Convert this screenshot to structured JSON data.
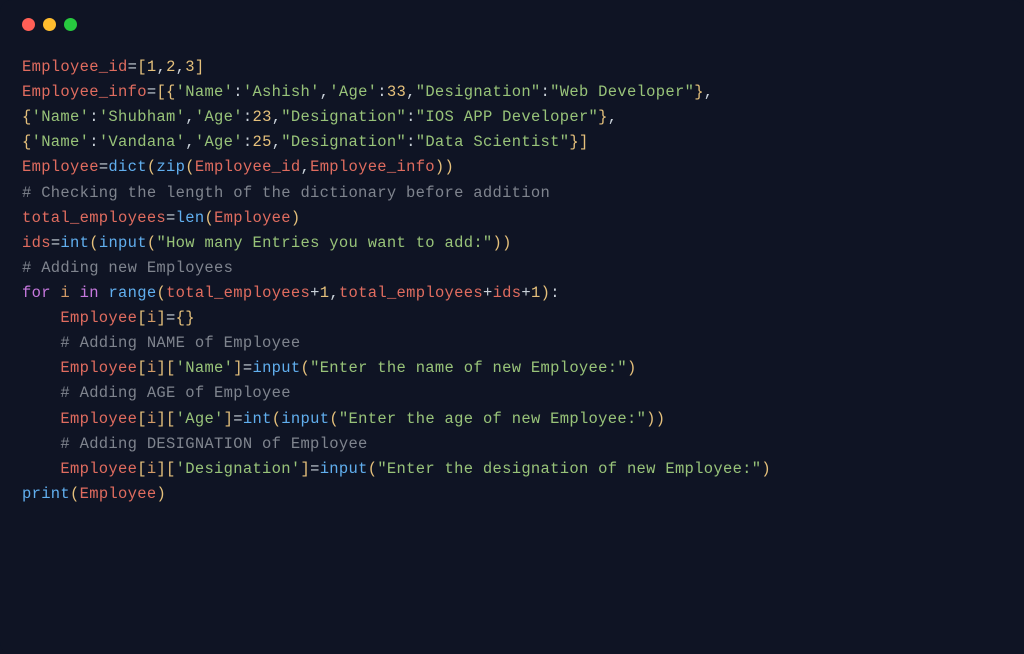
{
  "window": {
    "controls": [
      "close",
      "minimize",
      "maximize"
    ]
  },
  "code": {
    "lines": [
      [
        {
          "t": "Employee_id",
          "c": "var"
        },
        {
          "t": "=",
          "c": "op"
        },
        {
          "t": "[",
          "c": "br"
        },
        {
          "t": "1",
          "c": "num"
        },
        {
          "t": ",",
          "c": "pun"
        },
        {
          "t": "2",
          "c": "num"
        },
        {
          "t": ",",
          "c": "pun"
        },
        {
          "t": "3",
          "c": "num"
        },
        {
          "t": "]",
          "c": "br"
        }
      ],
      [
        {
          "t": "Employee_info",
          "c": "var"
        },
        {
          "t": "=",
          "c": "op"
        },
        {
          "t": "[{",
          "c": "br"
        },
        {
          "t": "'Name'",
          "c": "str"
        },
        {
          "t": ":",
          "c": "pun"
        },
        {
          "t": "'Ashish'",
          "c": "str"
        },
        {
          "t": ",",
          "c": "pun"
        },
        {
          "t": "'Age'",
          "c": "str"
        },
        {
          "t": ":",
          "c": "pun"
        },
        {
          "t": "33",
          "c": "num"
        },
        {
          "t": ",",
          "c": "pun"
        },
        {
          "t": "\"Designation\"",
          "c": "str"
        },
        {
          "t": ":",
          "c": "pun"
        },
        {
          "t": "\"Web Developer\"",
          "c": "str"
        },
        {
          "t": "}",
          "c": "br"
        },
        {
          "t": ",",
          "c": "pun"
        }
      ],
      [
        {
          "t": "{",
          "c": "br"
        },
        {
          "t": "'Name'",
          "c": "str"
        },
        {
          "t": ":",
          "c": "pun"
        },
        {
          "t": "'Shubham'",
          "c": "str"
        },
        {
          "t": ",",
          "c": "pun"
        },
        {
          "t": "'Age'",
          "c": "str"
        },
        {
          "t": ":",
          "c": "pun"
        },
        {
          "t": "23",
          "c": "num"
        },
        {
          "t": ",",
          "c": "pun"
        },
        {
          "t": "\"Designation\"",
          "c": "str"
        },
        {
          "t": ":",
          "c": "pun"
        },
        {
          "t": "\"IOS APP Developer\"",
          "c": "str"
        },
        {
          "t": "}",
          "c": "br"
        },
        {
          "t": ",",
          "c": "pun"
        }
      ],
      [
        {
          "t": "{",
          "c": "br"
        },
        {
          "t": "'Name'",
          "c": "str"
        },
        {
          "t": ":",
          "c": "pun"
        },
        {
          "t": "'Vandana'",
          "c": "str"
        },
        {
          "t": ",",
          "c": "pun"
        },
        {
          "t": "'Age'",
          "c": "str"
        },
        {
          "t": ":",
          "c": "pun"
        },
        {
          "t": "25",
          "c": "num"
        },
        {
          "t": ",",
          "c": "pun"
        },
        {
          "t": "\"Designation\"",
          "c": "str"
        },
        {
          "t": ":",
          "c": "pun"
        },
        {
          "t": "\"Data Scientist\"",
          "c": "str"
        },
        {
          "t": "}]",
          "c": "br"
        }
      ],
      [
        {
          "t": "Employee",
          "c": "var"
        },
        {
          "t": "=",
          "c": "op"
        },
        {
          "t": "dict",
          "c": "fn"
        },
        {
          "t": "(",
          "c": "br"
        },
        {
          "t": "zip",
          "c": "fn"
        },
        {
          "t": "(",
          "c": "br"
        },
        {
          "t": "Employee_id",
          "c": "var"
        },
        {
          "t": ",",
          "c": "pun"
        },
        {
          "t": "Employee_info",
          "c": "var"
        },
        {
          "t": "))",
          "c": "br"
        }
      ],
      [
        {
          "t": "# Checking the length of the dictionary before addition",
          "c": "com"
        }
      ],
      [
        {
          "t": "total_employees",
          "c": "var"
        },
        {
          "t": "=",
          "c": "op"
        },
        {
          "t": "len",
          "c": "fn"
        },
        {
          "t": "(",
          "c": "br"
        },
        {
          "t": "Employee",
          "c": "var"
        },
        {
          "t": ")",
          "c": "br"
        }
      ],
      [
        {
          "t": "ids",
          "c": "var"
        },
        {
          "t": "=",
          "c": "op"
        },
        {
          "t": "int",
          "c": "fn"
        },
        {
          "t": "(",
          "c": "br"
        },
        {
          "t": "input",
          "c": "fn"
        },
        {
          "t": "(",
          "c": "br"
        },
        {
          "t": "\"How many Entries you want to add:\"",
          "c": "str"
        },
        {
          "t": "))",
          "c": "br"
        }
      ],
      [
        {
          "t": "# Adding new Employees",
          "c": "com"
        }
      ],
      [
        {
          "t": "for",
          "c": "kw"
        },
        {
          "t": " ",
          "c": "op"
        },
        {
          "t": "i",
          "c": "id"
        },
        {
          "t": " ",
          "c": "op"
        },
        {
          "t": "in",
          "c": "kw"
        },
        {
          "t": " ",
          "c": "op"
        },
        {
          "t": "range",
          "c": "fn"
        },
        {
          "t": "(",
          "c": "br"
        },
        {
          "t": "total_employees",
          "c": "var"
        },
        {
          "t": "+",
          "c": "op"
        },
        {
          "t": "1",
          "c": "num"
        },
        {
          "t": ",",
          "c": "pun"
        },
        {
          "t": "total_employees",
          "c": "var"
        },
        {
          "t": "+",
          "c": "op"
        },
        {
          "t": "ids",
          "c": "var"
        },
        {
          "t": "+",
          "c": "op"
        },
        {
          "t": "1",
          "c": "num"
        },
        {
          "t": ")",
          "c": "br"
        },
        {
          "t": ":",
          "c": "pun"
        }
      ],
      [
        {
          "t": "    ",
          "c": "op"
        },
        {
          "t": "Employee",
          "c": "var"
        },
        {
          "t": "[",
          "c": "br"
        },
        {
          "t": "i",
          "c": "id"
        },
        {
          "t": "]",
          "c": "br"
        },
        {
          "t": "=",
          "c": "op"
        },
        {
          "t": "{}",
          "c": "br"
        }
      ],
      [
        {
          "t": "    ",
          "c": "op"
        },
        {
          "t": "# Adding NAME of Employee",
          "c": "com"
        }
      ],
      [
        {
          "t": "    ",
          "c": "op"
        },
        {
          "t": "Employee",
          "c": "var"
        },
        {
          "t": "[",
          "c": "br"
        },
        {
          "t": "i",
          "c": "id"
        },
        {
          "t": "][",
          "c": "br"
        },
        {
          "t": "'Name'",
          "c": "str"
        },
        {
          "t": "]",
          "c": "br"
        },
        {
          "t": "=",
          "c": "op"
        },
        {
          "t": "input",
          "c": "fn"
        },
        {
          "t": "(",
          "c": "br"
        },
        {
          "t": "\"Enter the name of new Employee:\"",
          "c": "str"
        },
        {
          "t": ")",
          "c": "br"
        }
      ],
      [
        {
          "t": "    ",
          "c": "op"
        },
        {
          "t": "# Adding AGE of Employee",
          "c": "com"
        }
      ],
      [
        {
          "t": "    ",
          "c": "op"
        },
        {
          "t": "Employee",
          "c": "var"
        },
        {
          "t": "[",
          "c": "br"
        },
        {
          "t": "i",
          "c": "id"
        },
        {
          "t": "][",
          "c": "br"
        },
        {
          "t": "'Age'",
          "c": "str"
        },
        {
          "t": "]",
          "c": "br"
        },
        {
          "t": "=",
          "c": "op"
        },
        {
          "t": "int",
          "c": "fn"
        },
        {
          "t": "(",
          "c": "br"
        },
        {
          "t": "input",
          "c": "fn"
        },
        {
          "t": "(",
          "c": "br"
        },
        {
          "t": "\"Enter the age of new Employee:\"",
          "c": "str"
        },
        {
          "t": "))",
          "c": "br"
        }
      ],
      [
        {
          "t": "    ",
          "c": "op"
        },
        {
          "t": "# Adding DESIGNATION of Employee",
          "c": "com"
        }
      ],
      [
        {
          "t": "    ",
          "c": "op"
        },
        {
          "t": "Employee",
          "c": "var"
        },
        {
          "t": "[",
          "c": "br"
        },
        {
          "t": "i",
          "c": "id"
        },
        {
          "t": "][",
          "c": "br"
        },
        {
          "t": "'Designation'",
          "c": "str"
        },
        {
          "t": "]",
          "c": "br"
        },
        {
          "t": "=",
          "c": "op"
        },
        {
          "t": "input",
          "c": "fn"
        },
        {
          "t": "(",
          "c": "br"
        },
        {
          "t": "\"Enter the designation of new Employee:\"",
          "c": "str"
        },
        {
          "t": ")",
          "c": "br"
        }
      ],
      [
        {
          "t": "print",
          "c": "fn"
        },
        {
          "t": "(",
          "c": "br"
        },
        {
          "t": "Employee",
          "c": "var"
        },
        {
          "t": ")",
          "c": "br"
        }
      ]
    ]
  }
}
